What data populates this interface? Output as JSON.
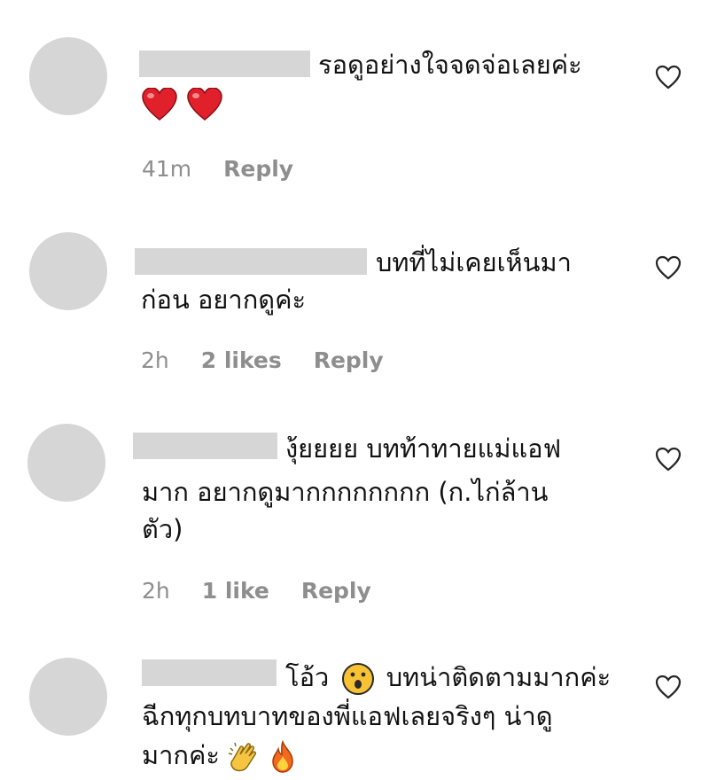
{
  "comments": [
    {
      "lines": [
        "รอดูอย่างใจจดจ่อเลยค่ะ"
      ],
      "emoji_line": [
        "red-heart",
        "red-heart"
      ],
      "time": "41m",
      "likes": "",
      "reply": "Reply"
    },
    {
      "lines": [
        "บทที่ไม่เคยเห็นมา",
        "ก่อน อยากดูค่ะ"
      ],
      "time": "2h",
      "likes": "2 likes",
      "reply": "Reply"
    },
    {
      "lines": [
        "งุ้ยยยย บทท้าทายแม่แอฟ",
        "มาก อยากดูมากกกกกกกก (ก.ไก่ล้าน",
        "ตัว)"
      ],
      "time": "2h",
      "likes": "1 like",
      "reply": "Reply"
    },
    {
      "lines": [
        "โอ้ว",
        "บทน่าติดตามมากค่ะ",
        "ฉีกทุกบทบาทของพี่แอฟเลยจริงๆ น่าดู",
        "มากค่ะ"
      ],
      "inline_emoji": [
        "surprised-face",
        "clapping-hands",
        "fire"
      ],
      "time": "",
      "likes": "",
      "reply": ""
    }
  ],
  "colors": {
    "placeholder": "#d6d6d6",
    "meta_text": "#8e8e8e",
    "heart_emoji": "#e0202a"
  }
}
